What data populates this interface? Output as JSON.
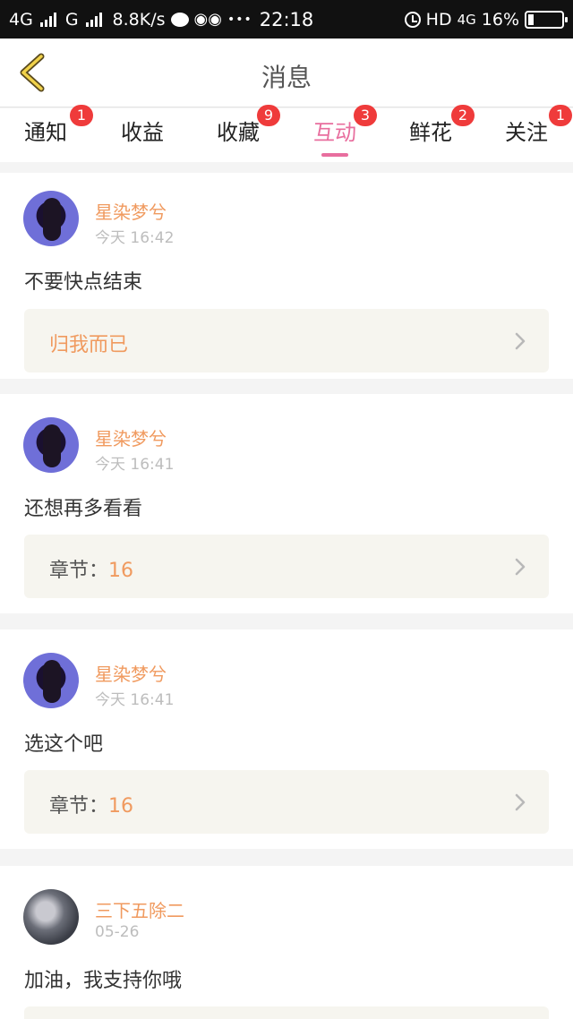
{
  "status_bar": {
    "network1": "4G",
    "network2": "G",
    "speed": "8.8K/s",
    "dots": "•••",
    "time": "22:18",
    "hd": "HD",
    "network3": "4G",
    "battery": "16%",
    "battery_level": 0.16
  },
  "header": {
    "title": "消息",
    "back_icon": "chevron-left-icon"
  },
  "tabs": [
    {
      "label": "通知",
      "badge": "1"
    },
    {
      "label": "收益",
      "badge": ""
    },
    {
      "label": "收藏",
      "badge": "9"
    },
    {
      "label": "互动",
      "badge": "3",
      "active": true
    },
    {
      "label": "鲜花",
      "badge": "2"
    },
    {
      "label": "关注",
      "badge": "1"
    }
  ],
  "messages": [
    {
      "user": "星染梦兮",
      "time": "今天 16:42",
      "content": "不要快点结束",
      "ref_title": "归我而已"
    },
    {
      "user": "星染梦兮",
      "time": "今天 16:41",
      "content": "还想再多看看",
      "ref_label": "章节：",
      "ref_value": "16"
    },
    {
      "user": "星染梦兮",
      "time": "今天 16:41",
      "content": "选这个吧",
      "ref_label": "章节：",
      "ref_value": "16"
    },
    {
      "user": "三下五除二",
      "time": "05-26",
      "content": "加油，我支持你哦"
    }
  ],
  "colors": {
    "accent": "#e86e9e",
    "username": "#f09a5f",
    "badge": "#ef3b3b"
  }
}
